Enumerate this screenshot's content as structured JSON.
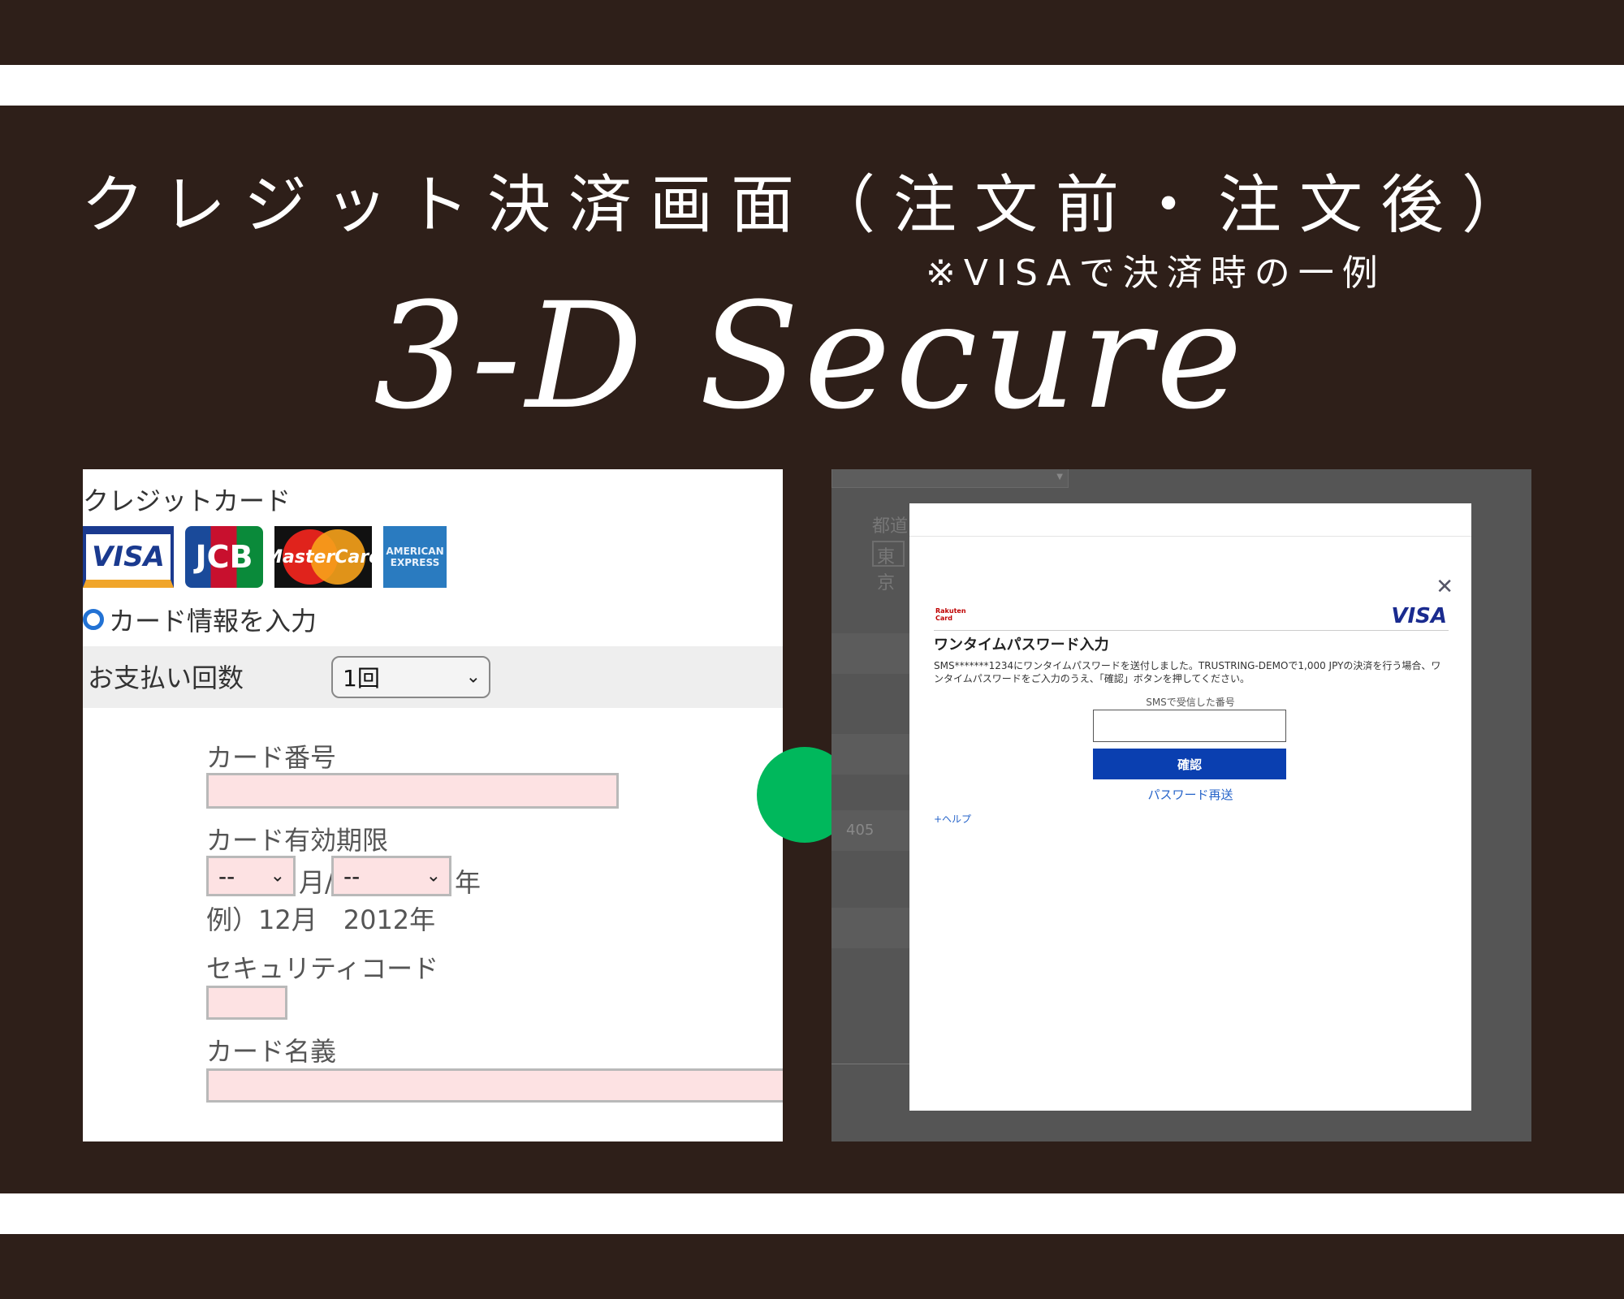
{
  "hero": {
    "title": "クレジット決済画面（注文前・注文後）",
    "subtitle": "※VISAで決済時の一例",
    "script_title": "3-D Secure"
  },
  "left_panel": {
    "heading": "クレジットカード",
    "card_brands": [
      "VISA",
      "JCB",
      "MasterCard",
      "AMERICAN EXPRESS"
    ],
    "radio_label": "カード情報を入力",
    "installments_label": "お支払い回数",
    "installments_value": "1回",
    "card_number_label": "カード番号",
    "expiry_label": "カード有効期限",
    "expiry_month_value": "--",
    "expiry_month_unit": "月/",
    "expiry_year_value": "--",
    "expiry_year_unit": "年",
    "expiry_example": "例）12月　2012年",
    "security_code_label": "セキュリティコード",
    "card_holder_label": "カード名義"
  },
  "right_panel": {
    "bg_label_prefecture": "都道",
    "bg_field_value": "東京",
    "bg_number": "405",
    "modal": {
      "issuer_logo": "Rakuten Card",
      "brand_logo": "VISA",
      "title": "ワンタイムパスワード入力",
      "message": "SMS*******1234にワンタイムパスワードを送付しました。TRUSTRING-DEMOで1,000 JPYの決済を行う場合、ワンタイムパスワードをご入力のうえ、「確認」ボタンを押してください。",
      "sms_label": "SMSで受信した番号",
      "confirm_label": "確認",
      "resend_label": "パスワード再送",
      "help_label": "+ヘルプ"
    }
  },
  "colors": {
    "background": "#2e1f19",
    "accent_green": "#00b85c",
    "confirm_button": "#0a3fb0",
    "input_pink": "#fde2e3"
  }
}
